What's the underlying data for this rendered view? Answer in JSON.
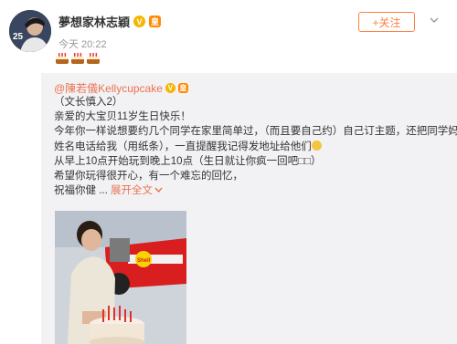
{
  "post": {
    "author": "夢想家林志穎",
    "verified_badge": "V",
    "vip_badge": "皇",
    "timestamp": "今天 20:22",
    "follow_label": "+关注",
    "more_icon": "chevron-down-icon",
    "content_emojis": [
      "cake-icon",
      "cake-icon",
      "cake-icon"
    ]
  },
  "repost": {
    "author": "@陳若儀Kellycupcake",
    "lines": [
      "（文长慎入2）",
      "亲爱的大宝贝11岁生日快乐！",
      "今年你一样说想要约几个同学在家里简单过，（而且要自己约）自己订主题，还把同学妈妈的",
      "姓名电话给我（用纸条），一直提醒我记得发地址给他们",
      "从早上10点开始玩到晚上10点（生日就让你疯一回吧□□）",
      "希望你玩得很开心，有一个难忘的回忆，",
      "祝福你健 ..."
    ],
    "expand_label": "展开全文",
    "expand_icon": "chevron-down-icon",
    "photo_alt": "boy with birthday cake"
  },
  "colors": {
    "accent": "#eb7350",
    "follow": "#ff8140",
    "repost_bg": "#f2f2f5"
  }
}
